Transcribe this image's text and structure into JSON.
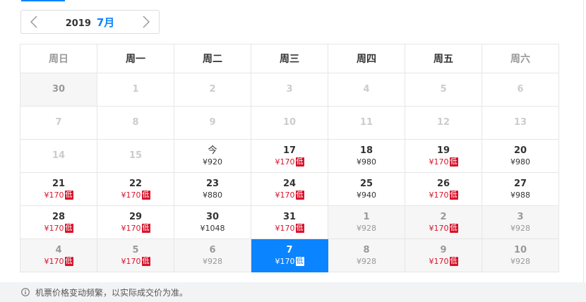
{
  "nav": {
    "year": "2019",
    "month": "7月"
  },
  "weekdays": [
    "周日",
    "周一",
    "周二",
    "周三",
    "周四",
    "周五",
    "周六"
  ],
  "weeks": [
    [
      {
        "day": "30",
        "price": "",
        "low": false,
        "state": "prev-month"
      },
      {
        "day": "1",
        "price": "",
        "low": false,
        "state": "disabled"
      },
      {
        "day": "2",
        "price": "",
        "low": false,
        "state": "disabled"
      },
      {
        "day": "3",
        "price": "",
        "low": false,
        "state": "disabled"
      },
      {
        "day": "4",
        "price": "",
        "low": false,
        "state": "disabled"
      },
      {
        "day": "5",
        "price": "",
        "low": false,
        "state": "disabled"
      },
      {
        "day": "6",
        "price": "",
        "low": false,
        "state": "disabled"
      }
    ],
    [
      {
        "day": "7",
        "price": "",
        "low": false,
        "state": "disabled"
      },
      {
        "day": "8",
        "price": "",
        "low": false,
        "state": "disabled"
      },
      {
        "day": "9",
        "price": "",
        "low": false,
        "state": "disabled"
      },
      {
        "day": "10",
        "price": "",
        "low": false,
        "state": "disabled"
      },
      {
        "day": "11",
        "price": "",
        "low": false,
        "state": "disabled"
      },
      {
        "day": "12",
        "price": "",
        "low": false,
        "state": "disabled"
      },
      {
        "day": "13",
        "price": "",
        "low": false,
        "state": "disabled"
      }
    ],
    [
      {
        "day": "14",
        "price": "",
        "low": false,
        "state": "disabled"
      },
      {
        "day": "15",
        "price": "",
        "low": false,
        "state": "disabled"
      },
      {
        "day": "今",
        "price": "¥920",
        "low": false,
        "state": "today"
      },
      {
        "day": "17",
        "price": "¥170",
        "low": true,
        "state": "normal"
      },
      {
        "day": "18",
        "price": "¥980",
        "low": false,
        "state": "normal"
      },
      {
        "day": "19",
        "price": "¥170",
        "low": true,
        "state": "normal"
      },
      {
        "day": "20",
        "price": "¥980",
        "low": false,
        "state": "normal"
      }
    ],
    [
      {
        "day": "21",
        "price": "¥170",
        "low": true,
        "state": "normal"
      },
      {
        "day": "22",
        "price": "¥170",
        "low": true,
        "state": "normal"
      },
      {
        "day": "23",
        "price": "¥880",
        "low": false,
        "state": "normal"
      },
      {
        "day": "24",
        "price": "¥170",
        "low": true,
        "state": "normal"
      },
      {
        "day": "25",
        "price": "¥940",
        "low": false,
        "state": "normal"
      },
      {
        "day": "26",
        "price": "¥170",
        "low": true,
        "state": "normal"
      },
      {
        "day": "27",
        "price": "¥988",
        "low": false,
        "state": "normal"
      }
    ],
    [
      {
        "day": "28",
        "price": "¥170",
        "low": true,
        "state": "normal"
      },
      {
        "day": "29",
        "price": "¥170",
        "low": true,
        "state": "normal"
      },
      {
        "day": "30",
        "price": "¥1048",
        "low": false,
        "state": "normal"
      },
      {
        "day": "31",
        "price": "¥170",
        "low": true,
        "state": "normal"
      },
      {
        "day": "1",
        "price": "¥928",
        "low": false,
        "state": "next-month"
      },
      {
        "day": "2",
        "price": "¥170",
        "low": true,
        "state": "next-month"
      },
      {
        "day": "3",
        "price": "¥928",
        "low": false,
        "state": "next-month"
      }
    ],
    [
      {
        "day": "4",
        "price": "¥170",
        "low": true,
        "state": "next-month"
      },
      {
        "day": "5",
        "price": "¥170",
        "low": true,
        "state": "next-month"
      },
      {
        "day": "6",
        "price": "¥928",
        "low": false,
        "state": "next-month"
      },
      {
        "day": "7",
        "price": "¥170",
        "low": true,
        "state": "selected"
      },
      {
        "day": "8",
        "price": "¥928",
        "low": false,
        "state": "next-month"
      },
      {
        "day": "9",
        "price": "¥170",
        "low": true,
        "state": "next-month"
      },
      {
        "day": "10",
        "price": "¥928",
        "low": false,
        "state": "next-month"
      }
    ]
  ],
  "low_badge_label": "低",
  "notice": "机票价格变动频繁，以实际成交价为准。",
  "colors": {
    "accent": "#0b84ff",
    "low": "#d9142c",
    "muted_bg": "#f6f6f6",
    "notice_bg": "#f2f3f5"
  },
  "icons": {
    "prev": "chevron-left-icon",
    "next": "chevron-right-icon",
    "notice": "info-circle-icon"
  }
}
